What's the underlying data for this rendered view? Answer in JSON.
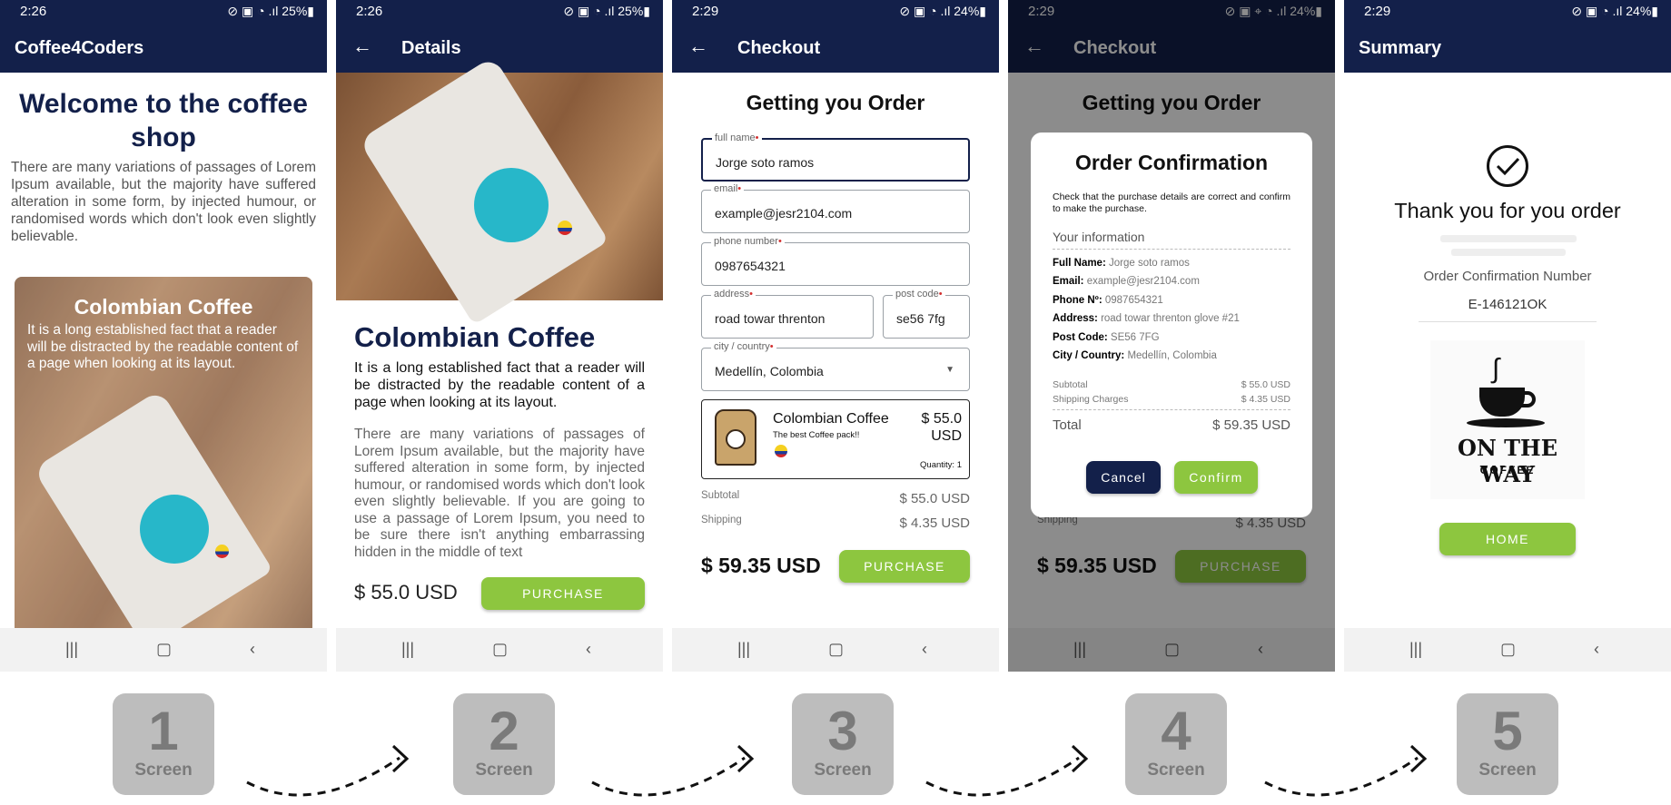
{
  "status": {
    "screen1_time": "2:26",
    "screen2_time": "2:26",
    "screen3_time": "2:29",
    "screen4_time": "2:29",
    "screen5_time": "2:29",
    "battery_25": "25%",
    "battery_24": "24%"
  },
  "screen1": {
    "appbar_title": "Coffee4Coders",
    "heading": "Welcome to the coffee shop",
    "intro": "There are many variations of passages of Lorem Ipsum available, but the majority have suffered alteration in some form, by injected humour, or randomised words which don't look even slightly believable.",
    "card_title": "Colombian Coffee",
    "card_text": "It is a long established fact that a reader will be distracted by the readable content of a page when looking at its layout."
  },
  "screen2": {
    "appbar_title": "Details",
    "title": "Colombian Coffee",
    "lead": "It is a long established fact that a reader will be distracted by the readable content of a page when looking at its layout.",
    "body": "There are many variations of passages of Lorem Ipsum available, but the majority have suffered alteration in some form, by injected humour, or randomised words which don't look even slightly believable. If you are going to use a passage of Lorem Ipsum, you need to be sure there isn't anything embarrassing hidden in the middle of text",
    "price": "$ 55.0 USD",
    "purchase_label": "PURCHASE"
  },
  "screen3": {
    "appbar_title": "Checkout",
    "heading": "Getting you Order",
    "fields": {
      "full_name_label": "full name",
      "full_name_value": "Jorge soto ramos",
      "email_label": "email",
      "email_value": "example@jesr2104.com",
      "phone_label": "phone number",
      "phone_value": "0987654321",
      "address_label": "address",
      "address_value": "road towar threnton",
      "postcode_label": "post code",
      "postcode_value": "se56 7fg",
      "city_label": "city / country",
      "city_value": "Medellín, Colombia"
    },
    "product": {
      "name": "Colombian Coffee",
      "tagline": "The best Coffee pack!!",
      "price": "$ 55.0 USD",
      "quantity": "Quantity: 1"
    },
    "subtotal_label": "Subtotal",
    "subtotal_value": "$ 55.0 USD",
    "shipping_label": "Shipping",
    "shipping_value": "$ 4.35 USD",
    "total": "$ 59.35 USD",
    "purchase_label": "PURCHASE"
  },
  "screen4": {
    "appbar_title": "Checkout",
    "bg_heading": "Getting you Order",
    "bg_shipping_label": "Shipping",
    "bg_shipping_value": "$ 4.35 USD",
    "bg_total": "$ 59.35 USD",
    "bg_purchase_label": "PURCHASE",
    "dialog": {
      "title": "Order Confirmation",
      "message": "Check that the purchase details are correct and confirm to make the purchase.",
      "section": "Your information",
      "full_name_label": "Full Name:",
      "full_name_value": "Jorge soto ramos",
      "email_label": "Email:",
      "email_value": "example@jesr2104.com",
      "phone_label": "Phone Nº:",
      "phone_value": "0987654321",
      "address_label": "Address:",
      "address_value": "road towar threnton glove #21",
      "postcode_label": "Post Code:",
      "postcode_value": "SE56 7FG",
      "city_label": "City / Country:",
      "city_value": "Medellín, Colombia",
      "subtotal_label": "Subtotal",
      "subtotal_value": "$ 55.0 USD",
      "shipping_label": "Shipping Charges",
      "shipping_value": "$ 4.35 USD",
      "total_label": "Total",
      "total_value": "$ 59.35 USD",
      "cancel_label": "Cancel",
      "confirm_label": "Confirm"
    }
  },
  "screen5": {
    "appbar_title": "Summary",
    "heading": "Thank you for you order",
    "number_label": "Order Confirmation Number",
    "number_value": "E-146121OK",
    "logo_line1": "ON THE WAY",
    "logo_line2": "COFFEE",
    "home_label": "HOME"
  },
  "steps": [
    {
      "number": "1",
      "word": "Screen"
    },
    {
      "number": "2",
      "word": "Screen"
    },
    {
      "number": "3",
      "word": "Screen"
    },
    {
      "number": "4",
      "word": "Screen"
    },
    {
      "number": "5",
      "word": "Screen"
    }
  ],
  "colors": {
    "navy": "#13204a",
    "green": "#8dc63f",
    "badge_teal": "#27b7c9"
  }
}
